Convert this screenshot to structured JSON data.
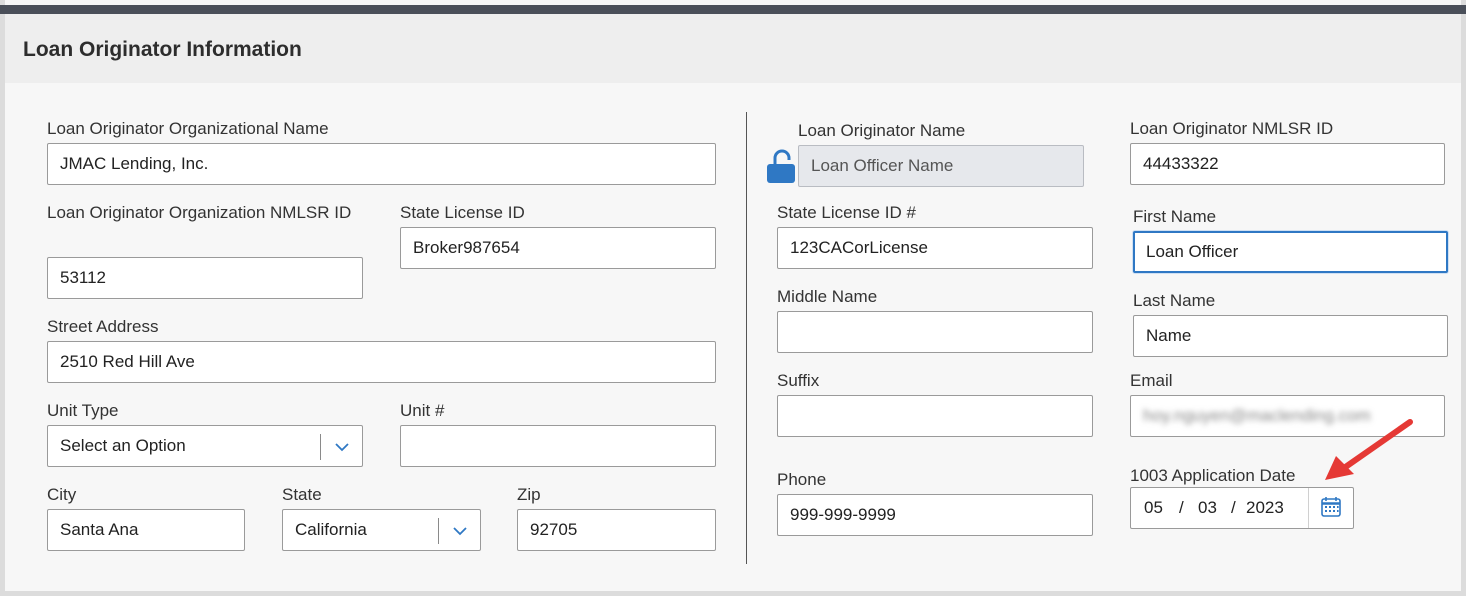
{
  "header": {
    "title": "Loan Originator Information"
  },
  "left": {
    "org_name": {
      "label": "Loan Originator Organizational Name",
      "value": "JMAC Lending, Inc."
    },
    "org_nmlsr": {
      "label": "Loan Originator Organization NMLSR ID",
      "value": "53112"
    },
    "state_license": {
      "label": "State License ID",
      "value": "Broker987654"
    },
    "street": {
      "label": "Street Address",
      "value": "2510 Red Hill Ave"
    },
    "unit_type": {
      "label": "Unit Type",
      "value": "Select an Option",
      "icon": "chevron-down-icon"
    },
    "unit_no": {
      "label": "Unit #",
      "value": ""
    },
    "city": {
      "label": "City",
      "value": "Santa Ana"
    },
    "state": {
      "label": "State",
      "value": "California",
      "icon": "chevron-down-icon"
    },
    "zip": {
      "label": "Zip",
      "value": "92705"
    }
  },
  "right": {
    "lo_name": {
      "label": "Loan Originator Name",
      "value": "Loan Officer Name",
      "icon": "unlock-icon"
    },
    "lo_nmlsr": {
      "label": "Loan Originator NMLSR ID",
      "value": "44433322"
    },
    "state_license": {
      "label": "State License ID #",
      "value": "123CACorLicense"
    },
    "first_name": {
      "label": "First Name",
      "value": "Loan Officer"
    },
    "middle_name": {
      "label": "Middle Name",
      "value": ""
    },
    "last_name": {
      "label": "Last Name",
      "value": "Name"
    },
    "suffix": {
      "label": "Suffix",
      "value": ""
    },
    "email": {
      "label": "Email",
      "value": "hoy.nguyen@maclending.com"
    },
    "phone": {
      "label": "Phone",
      "value": "999-999-9999"
    },
    "app_date": {
      "label": "1003 Application Date",
      "month": "05",
      "day": "03",
      "year": "2023",
      "sep": "/",
      "icon": "calendar-icon"
    }
  },
  "colors": {
    "accent": "#2f78c4",
    "topbar": "#4a4f59",
    "lock": "#2f78c4",
    "arrow": "#e53935"
  }
}
